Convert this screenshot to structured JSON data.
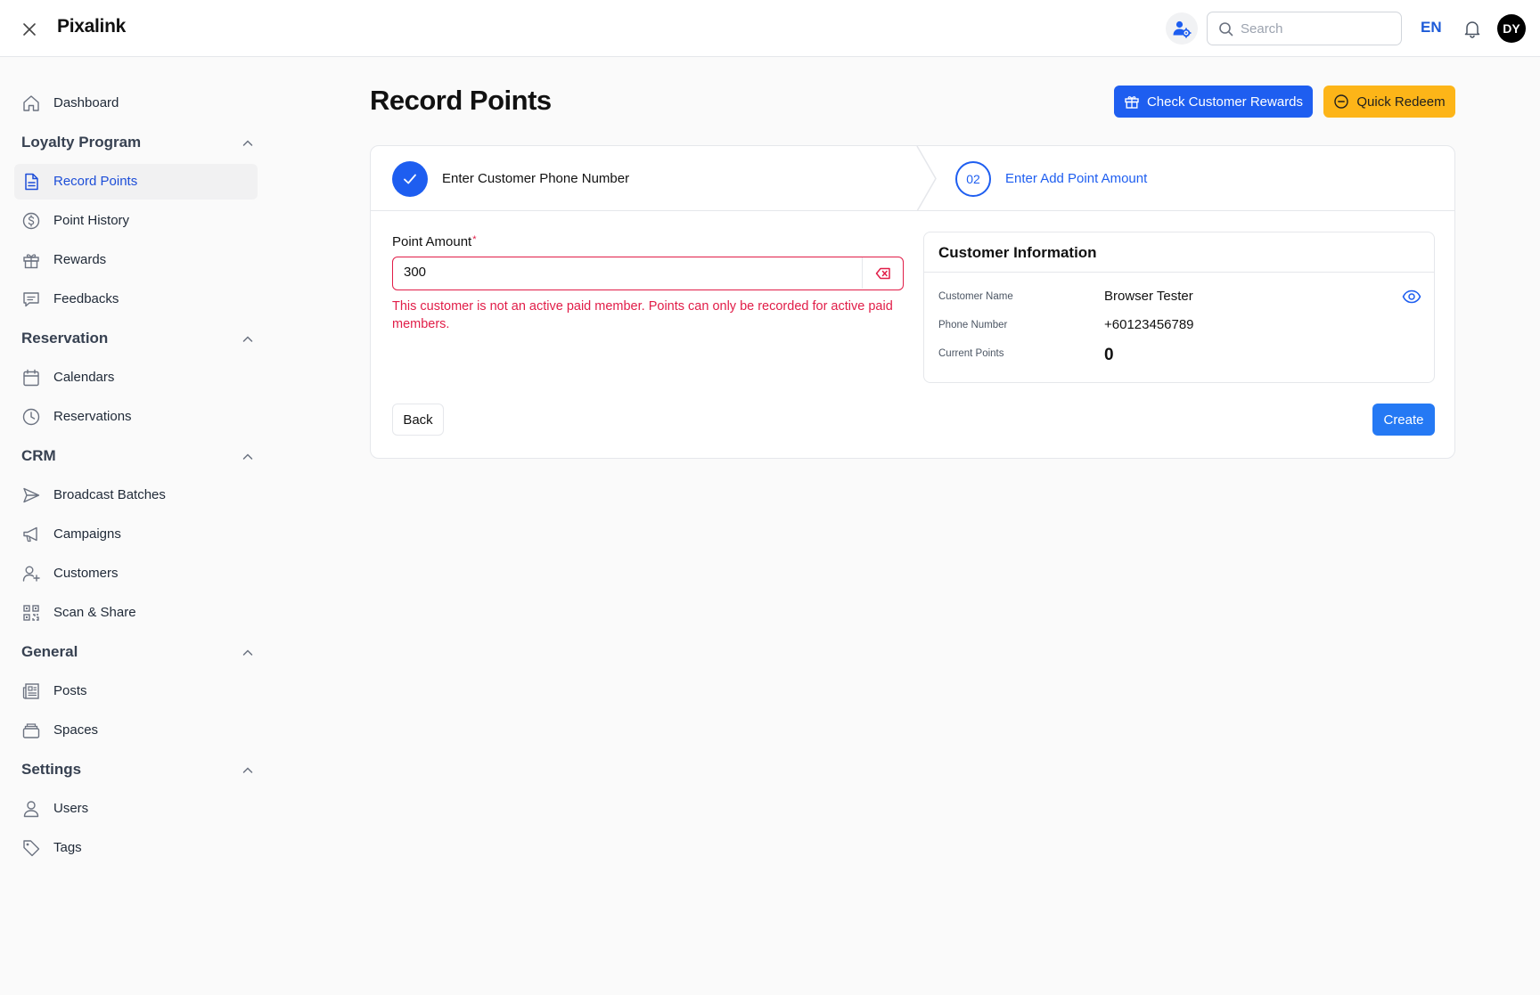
{
  "app": {
    "title": "Pixalink"
  },
  "header": {
    "search_placeholder": "Search",
    "language": "EN",
    "avatar_initials": "DY"
  },
  "sidebar": {
    "dashboard": "Dashboard",
    "sections": [
      {
        "title": "Loyalty Program",
        "items": [
          {
            "label": "Record Points",
            "icon": "document-icon",
            "active": true
          },
          {
            "label": "Point History",
            "icon": "dollar-circle-icon"
          },
          {
            "label": "Rewards",
            "icon": "gift-icon"
          },
          {
            "label": "Feedbacks",
            "icon": "chat-icon"
          }
        ]
      },
      {
        "title": "Reservation",
        "items": [
          {
            "label": "Calendars",
            "icon": "calendar-icon"
          },
          {
            "label": "Reservations",
            "icon": "clock-icon"
          }
        ]
      },
      {
        "title": "CRM",
        "items": [
          {
            "label": "Broadcast Batches",
            "icon": "send-icon"
          },
          {
            "label": "Campaigns",
            "icon": "megaphone-icon"
          },
          {
            "label": "Customers",
            "icon": "user-plus-icon"
          },
          {
            "label": "Scan & Share",
            "icon": "qr-code-icon"
          }
        ]
      },
      {
        "title": "General",
        "items": [
          {
            "label": "Posts",
            "icon": "newspaper-icon"
          },
          {
            "label": "Spaces",
            "icon": "layers-icon"
          }
        ]
      },
      {
        "title": "Settings",
        "items": [
          {
            "label": "Users",
            "icon": "user-icon"
          },
          {
            "label": "Tags",
            "icon": "tag-icon"
          }
        ]
      }
    ]
  },
  "main": {
    "title": "Record Points",
    "check_rewards_label": "Check Customer Rewards",
    "quick_redeem_label": "Quick Redeem",
    "steps": {
      "step1_label": "Enter Customer Phone Number",
      "step2_number": "02",
      "step2_label": "Enter Add Point Amount"
    },
    "form": {
      "point_amount_label": "Point Amount",
      "required_mark": "*",
      "point_amount_value": "300",
      "error": "This customer is not an active paid member. Points can only be recorded for active paid members."
    },
    "customer_info": {
      "title": "Customer Information",
      "name_label": "Customer Name",
      "name_value": "Browser Tester",
      "phone_label": "Phone Number",
      "phone_value": "+60123456789",
      "points_label": "Current Points",
      "points_value": "0"
    },
    "back_label": "Back",
    "create_label": "Create"
  },
  "colors": {
    "primary": "#1e5ef0",
    "create": "#2579f4",
    "warning": "#fdb518",
    "error": "#e11d48"
  }
}
